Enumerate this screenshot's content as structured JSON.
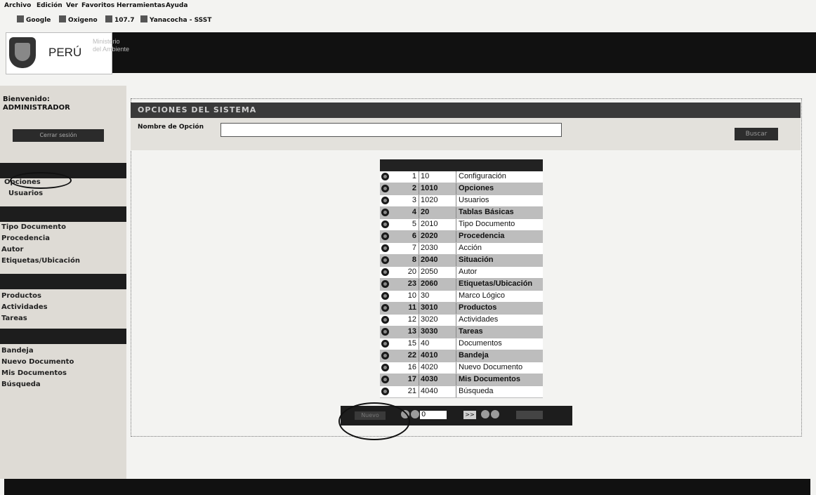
{
  "browser": {
    "menu": [
      "Archivo",
      "Edición",
      "Ver",
      "Favoritos",
      "Herramientas",
      "Ayuda"
    ],
    "favorites": [
      "Google",
      "Oxigeno",
      "107.7",
      "Yanacocha - SSST"
    ]
  },
  "header": {
    "country": "PERÚ",
    "ministry_line1": "Ministerio",
    "ministry_line2": "del Ambiente"
  },
  "sidebar": {
    "welcome_label": "Bienvenido:",
    "user": "ADMINISTRADOR",
    "logout_label": "Cerrar sesión",
    "group1": [
      "Opciones",
      "Usuarios"
    ],
    "group2": [
      "Tipo Documento",
      "Procedencia",
      "Autor",
      "Etiquetas/Ubicación"
    ],
    "group3": [
      "Productos",
      "Actividades",
      "Tareas"
    ],
    "group4": [
      "Bandeja",
      "Nuevo Documento",
      "Mis Documentos",
      "Búsqueda"
    ]
  },
  "main": {
    "title": "OPCIONES DEL SISTEMA",
    "filter_label": "Nombre de Opción",
    "filter_value": "",
    "search_button": "Buscar"
  },
  "grid": {
    "rows": [
      {
        "num": "1",
        "code": "10",
        "name": "Configuración"
      },
      {
        "num": "2",
        "code": "1010",
        "name": "Opciones"
      },
      {
        "num": "3",
        "code": "1020",
        "name": "Usuarios"
      },
      {
        "num": "4",
        "code": "20",
        "name": "Tablas Básicas"
      },
      {
        "num": "5",
        "code": "2010",
        "name": "Tipo Documento"
      },
      {
        "num": "6",
        "code": "2020",
        "name": "Procedencia"
      },
      {
        "num": "7",
        "code": "2030",
        "name": "Acción"
      },
      {
        "num": "8",
        "code": "2040",
        "name": "Situación"
      },
      {
        "num": "20",
        "code": "2050",
        "name": "Autor"
      },
      {
        "num": "23",
        "code": "2060",
        "name": "Etiquetas/Ubicación"
      },
      {
        "num": "10",
        "code": "30",
        "name": "Marco Lógico"
      },
      {
        "num": "11",
        "code": "3010",
        "name": "Productos"
      },
      {
        "num": "12",
        "code": "3020",
        "name": "Actividades"
      },
      {
        "num": "13",
        "code": "3030",
        "name": "Tareas"
      },
      {
        "num": "15",
        "code": "40",
        "name": "Documentos"
      },
      {
        "num": "22",
        "code": "4010",
        "name": "Bandeja"
      },
      {
        "num": "16",
        "code": "4020",
        "name": "Nuevo Documento"
      },
      {
        "num": "17",
        "code": "4030",
        "name": "Mis Documentos"
      },
      {
        "num": "21",
        "code": "4040",
        "name": "Búsqueda"
      }
    ]
  },
  "pager": {
    "new_button": "Nuevo",
    "page_value": "0",
    "go_label": ">>"
  }
}
